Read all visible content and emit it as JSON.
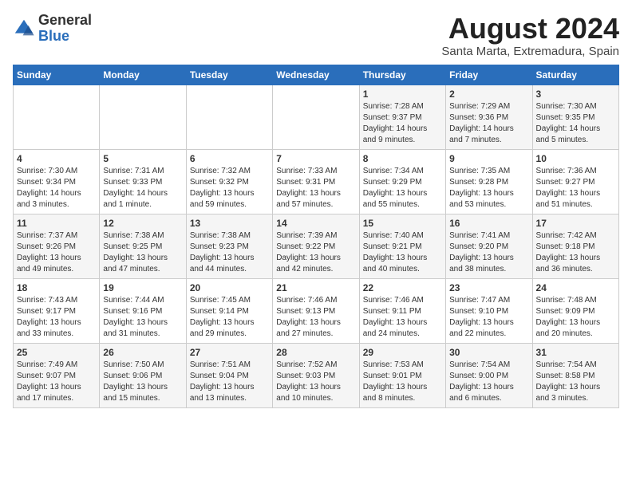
{
  "logo": {
    "general": "General",
    "blue": "Blue"
  },
  "title": {
    "month_year": "August 2024",
    "location": "Santa Marta, Extremadura, Spain"
  },
  "days_of_week": [
    "Sunday",
    "Monday",
    "Tuesday",
    "Wednesday",
    "Thursday",
    "Friday",
    "Saturday"
  ],
  "weeks": [
    [
      {
        "day": "",
        "info": ""
      },
      {
        "day": "",
        "info": ""
      },
      {
        "day": "",
        "info": ""
      },
      {
        "day": "",
        "info": ""
      },
      {
        "day": "1",
        "info": "Sunrise: 7:28 AM\nSunset: 9:37 PM\nDaylight: 14 hours\nand 9 minutes."
      },
      {
        "day": "2",
        "info": "Sunrise: 7:29 AM\nSunset: 9:36 PM\nDaylight: 14 hours\nand 7 minutes."
      },
      {
        "day": "3",
        "info": "Sunrise: 7:30 AM\nSunset: 9:35 PM\nDaylight: 14 hours\nand 5 minutes."
      }
    ],
    [
      {
        "day": "4",
        "info": "Sunrise: 7:30 AM\nSunset: 9:34 PM\nDaylight: 14 hours\nand 3 minutes."
      },
      {
        "day": "5",
        "info": "Sunrise: 7:31 AM\nSunset: 9:33 PM\nDaylight: 14 hours\nand 1 minute."
      },
      {
        "day": "6",
        "info": "Sunrise: 7:32 AM\nSunset: 9:32 PM\nDaylight: 13 hours\nand 59 minutes."
      },
      {
        "day": "7",
        "info": "Sunrise: 7:33 AM\nSunset: 9:31 PM\nDaylight: 13 hours\nand 57 minutes."
      },
      {
        "day": "8",
        "info": "Sunrise: 7:34 AM\nSunset: 9:29 PM\nDaylight: 13 hours\nand 55 minutes."
      },
      {
        "day": "9",
        "info": "Sunrise: 7:35 AM\nSunset: 9:28 PM\nDaylight: 13 hours\nand 53 minutes."
      },
      {
        "day": "10",
        "info": "Sunrise: 7:36 AM\nSunset: 9:27 PM\nDaylight: 13 hours\nand 51 minutes."
      }
    ],
    [
      {
        "day": "11",
        "info": "Sunrise: 7:37 AM\nSunset: 9:26 PM\nDaylight: 13 hours\nand 49 minutes."
      },
      {
        "day": "12",
        "info": "Sunrise: 7:38 AM\nSunset: 9:25 PM\nDaylight: 13 hours\nand 47 minutes."
      },
      {
        "day": "13",
        "info": "Sunrise: 7:38 AM\nSunset: 9:23 PM\nDaylight: 13 hours\nand 44 minutes."
      },
      {
        "day": "14",
        "info": "Sunrise: 7:39 AM\nSunset: 9:22 PM\nDaylight: 13 hours\nand 42 minutes."
      },
      {
        "day": "15",
        "info": "Sunrise: 7:40 AM\nSunset: 9:21 PM\nDaylight: 13 hours\nand 40 minutes."
      },
      {
        "day": "16",
        "info": "Sunrise: 7:41 AM\nSunset: 9:20 PM\nDaylight: 13 hours\nand 38 minutes."
      },
      {
        "day": "17",
        "info": "Sunrise: 7:42 AM\nSunset: 9:18 PM\nDaylight: 13 hours\nand 36 minutes."
      }
    ],
    [
      {
        "day": "18",
        "info": "Sunrise: 7:43 AM\nSunset: 9:17 PM\nDaylight: 13 hours\nand 33 minutes."
      },
      {
        "day": "19",
        "info": "Sunrise: 7:44 AM\nSunset: 9:16 PM\nDaylight: 13 hours\nand 31 minutes."
      },
      {
        "day": "20",
        "info": "Sunrise: 7:45 AM\nSunset: 9:14 PM\nDaylight: 13 hours\nand 29 minutes."
      },
      {
        "day": "21",
        "info": "Sunrise: 7:46 AM\nSunset: 9:13 PM\nDaylight: 13 hours\nand 27 minutes."
      },
      {
        "day": "22",
        "info": "Sunrise: 7:46 AM\nSunset: 9:11 PM\nDaylight: 13 hours\nand 24 minutes."
      },
      {
        "day": "23",
        "info": "Sunrise: 7:47 AM\nSunset: 9:10 PM\nDaylight: 13 hours\nand 22 minutes."
      },
      {
        "day": "24",
        "info": "Sunrise: 7:48 AM\nSunset: 9:09 PM\nDaylight: 13 hours\nand 20 minutes."
      }
    ],
    [
      {
        "day": "25",
        "info": "Sunrise: 7:49 AM\nSunset: 9:07 PM\nDaylight: 13 hours\nand 17 minutes."
      },
      {
        "day": "26",
        "info": "Sunrise: 7:50 AM\nSunset: 9:06 PM\nDaylight: 13 hours\nand 15 minutes."
      },
      {
        "day": "27",
        "info": "Sunrise: 7:51 AM\nSunset: 9:04 PM\nDaylight: 13 hours\nand 13 minutes."
      },
      {
        "day": "28",
        "info": "Sunrise: 7:52 AM\nSunset: 9:03 PM\nDaylight: 13 hours\nand 10 minutes."
      },
      {
        "day": "29",
        "info": "Sunrise: 7:53 AM\nSunset: 9:01 PM\nDaylight: 13 hours\nand 8 minutes."
      },
      {
        "day": "30",
        "info": "Sunrise: 7:54 AM\nSunset: 9:00 PM\nDaylight: 13 hours\nand 6 minutes."
      },
      {
        "day": "31",
        "info": "Sunrise: 7:54 AM\nSunset: 8:58 PM\nDaylight: 13 hours\nand 3 minutes."
      }
    ]
  ]
}
